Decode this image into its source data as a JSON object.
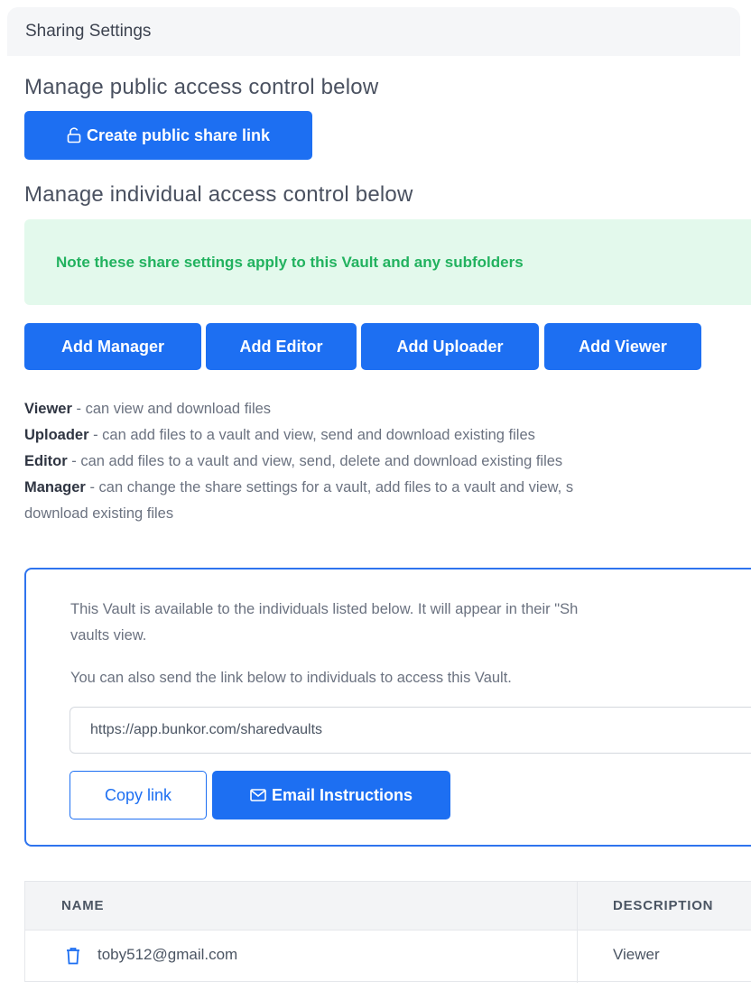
{
  "header": {
    "title": "Sharing Settings"
  },
  "public_section": {
    "title": "Manage public access control below",
    "create_link_label": "Create public share link"
  },
  "individual_section": {
    "title": "Manage individual access control below",
    "note": "Note these share settings apply to this Vault and any subfolders",
    "buttons": {
      "manager": "Add Manager",
      "editor": "Add Editor",
      "uploader": "Add Uploader",
      "viewer": "Add Viewer"
    },
    "roles": [
      {
        "name": "Viewer",
        "desc": " - can view and download files"
      },
      {
        "name": "Uploader",
        "desc": " - can add files to a vault and view, send and download existing files"
      },
      {
        "name": "Editor",
        "desc": " - can add files to a vault and view, send, delete and download existing files"
      },
      {
        "name": "Manager",
        "desc": " - can change the share settings for a vault, add files to a vault and view, s"
      }
    ],
    "roles_tail": "download existing files"
  },
  "card": {
    "p1_line1": "This Vault is available to the individuals listed below. It will appear in their \"Sh",
    "p1_line2": "vaults view.",
    "p2": "You can also send the link below to individuals to access this Vault.",
    "link_value": "https://app.bunkor.com/sharedvaults",
    "copy_label": "Copy link",
    "email_label": "Email Instructions"
  },
  "table": {
    "headers": {
      "name": "NAME",
      "description": "DESCRIPTION"
    },
    "rows": [
      {
        "email": "toby512@gmail.com",
        "role": "Viewer"
      }
    ]
  },
  "colors": {
    "primary": "#1d6ff2",
    "note_bg": "#e3f9ec",
    "note_text": "#22b25f"
  },
  "icons": {
    "lock": "unlock-icon",
    "mail": "mail-icon",
    "trash": "trash-icon"
  }
}
